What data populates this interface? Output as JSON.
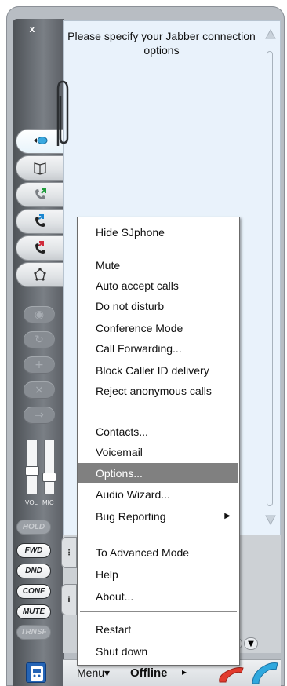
{
  "window": {
    "close_label": "x",
    "message": "Please specify your Jabber connection options"
  },
  "left_buttons": [
    {
      "label": "HOLD",
      "enabled": false
    },
    {
      "label": "FWD",
      "enabled": true
    },
    {
      "label": "DND",
      "enabled": true
    },
    {
      "label": "CONF",
      "enabled": true
    },
    {
      "label": "MUTE",
      "enabled": true
    },
    {
      "label": "TRNSF",
      "enabled": false
    }
  ],
  "sliders": {
    "vol_label": "VOL",
    "mic_label": "MIC"
  },
  "bottom_tabs": [
    "",
    "i"
  ],
  "status_bar": {
    "menu_label": "Menu▾",
    "status_label": "Offline",
    "status_arrow": "▸"
  },
  "context_menu": {
    "items": [
      {
        "label": "Hide SJphone"
      },
      {
        "label": "Mute"
      },
      {
        "label": "Auto accept calls"
      },
      {
        "label": "Do not disturb"
      },
      {
        "label": "Conference Mode"
      },
      {
        "label": "Call Forwarding..."
      },
      {
        "label": "Block Caller ID delivery"
      },
      {
        "label": "Reject anonymous calls"
      },
      {
        "label": "Contacts..."
      },
      {
        "label": "Voicemail"
      },
      {
        "label": "Options...",
        "highlighted": true
      },
      {
        "label": "Audio Wizard..."
      },
      {
        "label": "Bug Reporting",
        "submenu": true
      },
      {
        "label": "To Advanced Mode"
      },
      {
        "label": "Help"
      },
      {
        "label": "About..."
      },
      {
        "label": "Restart"
      },
      {
        "label": "Shut down"
      }
    ]
  },
  "icons": {
    "tab_chat": "chat-bubble-icon",
    "tab_book": "book-icon",
    "tab_call": "phone-call-icon",
    "tab_incoming": "incoming-call-icon",
    "tab_outgoing": "outgoing-call-icon",
    "tab_settings": "settings-icon",
    "logo": "sjphone-logo-icon",
    "hangup": "red-handset-icon",
    "call": "blue-handset-icon"
  },
  "colors": {
    "panel_bg": "#e9f2fb",
    "menu_highlight": "#808080"
  }
}
